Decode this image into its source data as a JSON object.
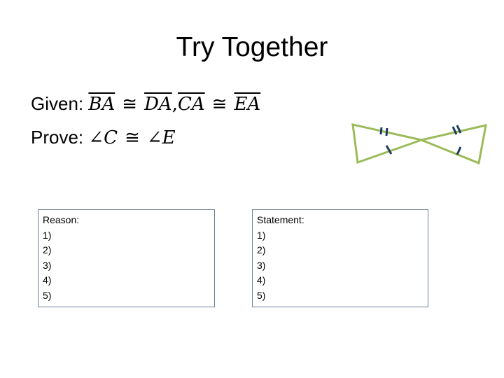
{
  "slide": {
    "title": "Try Together",
    "given": {
      "label": "Given:",
      "seg1": "BA",
      "congruent1": "≅",
      "seg2": "DA",
      "comma": ",",
      "seg3": "CA",
      "congruent2": "≅",
      "seg4": "EA"
    },
    "prove": {
      "label": "Prove:",
      "angle1": "∠C",
      "congruent": "≅",
      "angle2": "∠E"
    },
    "reason_box": {
      "header": "Reason:",
      "items": [
        "1)",
        "2)",
        "3)",
        "4)",
        "5)"
      ]
    },
    "statement_box": {
      "header": "Statement:",
      "items": [
        "1)",
        "2)",
        "3)",
        "4)",
        "5)"
      ]
    },
    "figure": {
      "description": "two triangles sharing a vertex (bowtie) with tick marks",
      "line_color": "#9bbb59",
      "tick_color": "#1f3a5f"
    }
  }
}
